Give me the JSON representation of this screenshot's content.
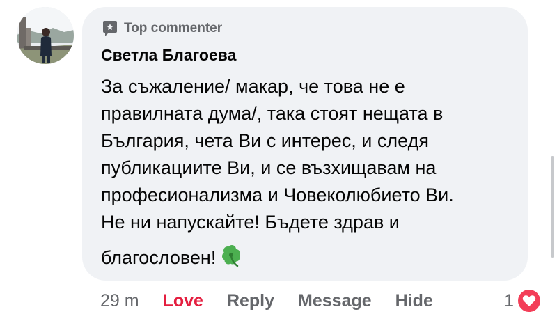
{
  "comment": {
    "badge": "Top commenter",
    "author": "Светла Благоева",
    "lines": [
      "За съжаление/ макар, че това не е",
      "правилната дума/, така стоят нещата в",
      "България, чета Ви  с интерес, и следя",
      "публикациите Ви, и  се възхищавам на",
      "професионализма и Човеколюбието Ви.",
      "Не ни напускайте! Бъдете здрав и",
      "благословен!"
    ],
    "emoji": "clover-icon"
  },
  "actions": {
    "time": "29 m",
    "love": "Love",
    "reply": "Reply",
    "message": "Message",
    "hide": "Hide"
  },
  "reactions": {
    "count": "1",
    "type": "heart-icon"
  },
  "colors": {
    "bubble": "#f0f2f5",
    "love": "#e41e3f",
    "heart": "#f33e58",
    "secondary_text": "#65676b"
  }
}
